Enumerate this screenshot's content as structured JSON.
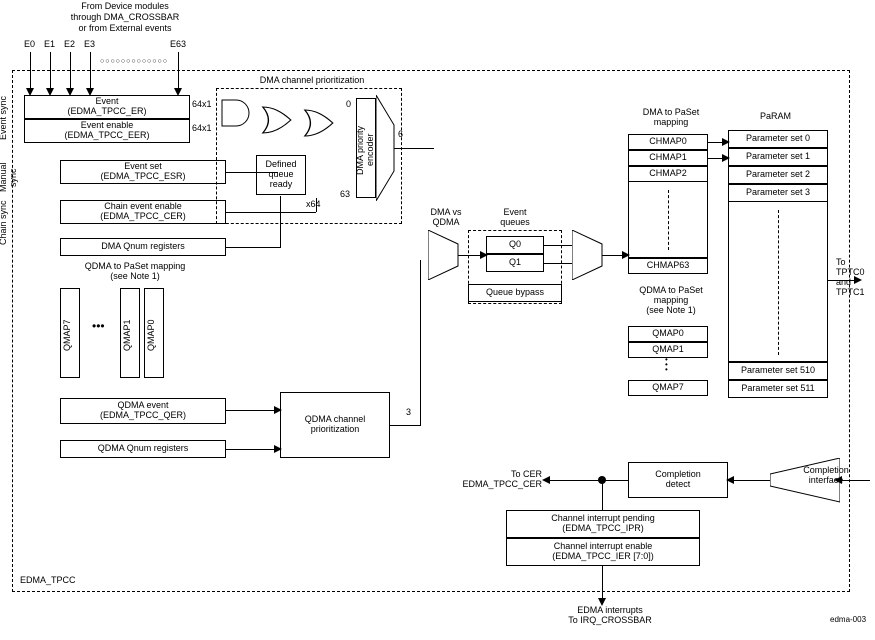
{
  "header": {
    "top_text_1": "From Device modules",
    "top_text_2": "through DMA_CROSSBAR",
    "top_text_3": "or from External events",
    "events": {
      "e0": "E0",
      "e1": "E1",
      "e2": "E2",
      "e3": "E3",
      "e63": "E63"
    }
  },
  "outer_dashed_label": "EDMA_TPCC",
  "sync_labels": {
    "event": "Event\nsync",
    "manual": "Manual\nsync",
    "chain": "Chain\nsync"
  },
  "event_block": {
    "event": "Event\n(EDMA_TPCC_ER)",
    "event_enable": "Event enable\n(EDMA_TPCC_EER)",
    "bus_64x1a": "64x1",
    "bus_64x1b": "64x1"
  },
  "manual_block": {
    "event_set": "Event set\n(EDMA_TPCC_ESR)"
  },
  "chain_block": {
    "chain_event_enable": "Chain event enable\n(EDMA_TPCC_CER)"
  },
  "dma_qnum": "DMA Qnum registers",
  "qdma_paset_label": "QDMA to PaSet mapping\n(see Note 1)",
  "qmap_vertical": {
    "qmap7": "QMAP7",
    "qmap1": "QMAP1",
    "qmap0": "QMAP0",
    "dots": "•••"
  },
  "qdma_event": "QDMA event\n(EDMA_TPCC_QER)",
  "qdma_qnum": "QDMA Qnum registers",
  "qdma_prio": "QDMA channel\nprioritization",
  "dma_prio_label": "DMA channel prioritization",
  "defined_queue": "Defined\nqueue\nready",
  "dma_prio_encoder": "DMA priority\nencoder",
  "prio_nums": {
    "zero": "0",
    "sixtythree": "63",
    "x64": "x64",
    "six": "6",
    "three": "3"
  },
  "dma_vs_qdma": "DMA vs\nQDMA",
  "event_queues_label": "Event\nqueues",
  "queues": {
    "q0": "Q0",
    "q1": "Q1"
  },
  "queue_bypass": "Queue bypass",
  "dma_paset_label": "DMA to PaSet\nmapping",
  "chmap": {
    "c0": "CHMAP0",
    "c1": "CHMAP1",
    "c2": "CHMAP2",
    "c63": "CHMAP63"
  },
  "qdma_paset_label2": "QDMA to PaSet\nmapping\n(see Note 1)",
  "qmap_right": {
    "q0": "QMAP0",
    "q1": "QMAP1",
    "q7": "QMAP7",
    "dots": "•\n•\n•"
  },
  "param_label": "PaRAM",
  "param": {
    "p0": "Parameter set 0",
    "p1": "Parameter set 1",
    "p2": "Parameter set 2",
    "p3": "Parameter set 3",
    "p510": "Parameter set 510",
    "p511": "Parameter set 511"
  },
  "to_tptc": "To TPTC0\nand\nTPTC1",
  "to_cer": "To CER\nEDMA_TPCC_CER",
  "completion_detect": "Completion\ndetect",
  "completion_interface": "Completion\ninterface",
  "channel_ipr": "Channel interrupt pending\n(EDMA_TPCC_IPR)",
  "channel_ier": "Channel interrupt enable\n(EDMA_TPCC_IER [7:0])",
  "edma_interrupts": "EDMA interrupts\nTo IRQ_CROSSBAR",
  "footer_id": "edma-003"
}
